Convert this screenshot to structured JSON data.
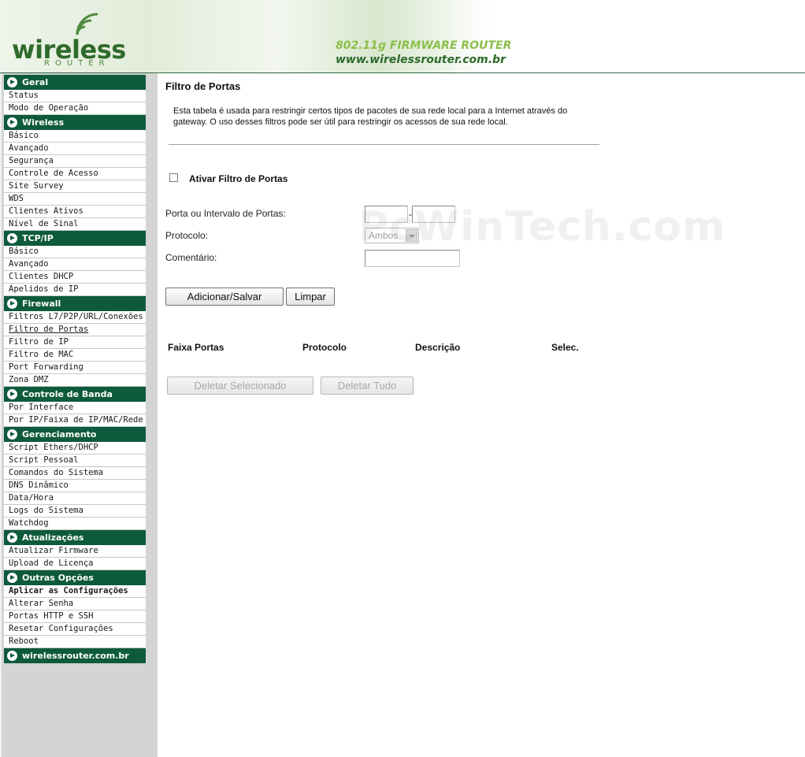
{
  "header": {
    "logo_word": "wireless",
    "logo_sub": "ROUTER",
    "tagline": "802.11g FIRMWARE ROUTER",
    "url": "www.wirelessrouter.com.br"
  },
  "sidebar": {
    "sections": [
      {
        "title": "Geral",
        "items": [
          "Status",
          "Modo de Operação"
        ]
      },
      {
        "title": "Wireless",
        "items": [
          "Básico",
          "Avançado",
          "Segurança",
          "Controle de Acesso",
          "Site Survey",
          "WDS",
          "Clientes Ativos",
          "Nível de Sinal"
        ]
      },
      {
        "title": "TCP/IP",
        "items": [
          "Básico",
          "Avançado",
          "Clientes DHCP",
          "Apelidos de IP"
        ]
      },
      {
        "title": "Firewall",
        "items": [
          "Filtros L7/P2P/URL/Conexões",
          "Filtro de Portas",
          "Filtro de IP",
          "Filtro de MAC",
          "Port Forwarding",
          "Zona DMZ"
        ]
      },
      {
        "title": "Controle de Banda",
        "items": [
          "Por Interface",
          "Por IP/Faixa de IP/MAC/Rede"
        ]
      },
      {
        "title": "Gerenciamento",
        "items": [
          "Script Ethers/DHCP",
          "Script Pessoal",
          "Comandos do Sistema",
          "DNS Dinâmico",
          "Data/Hora",
          "Logs do Sistema",
          "Watchdog"
        ]
      },
      {
        "title": "Atualizações",
        "items": [
          "Atualizar Firmware",
          "Upload de Licença"
        ]
      },
      {
        "title": "Outras Opções",
        "items": [
          "Aplicar as Configurações",
          "Alterar Senha",
          "Portas HTTP e SSH",
          "Resetar Configurações",
          "Reboot"
        ]
      },
      {
        "title": "wirelessrouter.com.br",
        "items": []
      }
    ],
    "active_item": "Filtro de Portas",
    "bold_item": "Aplicar as Configurações"
  },
  "main": {
    "title": "Filtro de Portas",
    "description": "Esta tabela é usada para restringir certos tipos de pacotes de sua rede local para a Internet através do gateway. O uso desses filtros pode ser útil para restringir os acessos de sua rede local.",
    "enable_label": "Ativar Filtro de Portas",
    "enable_checked": false,
    "port_label": "Porta ou Intervalo de Portas:",
    "port_from": "",
    "port_separator": "-",
    "port_to": "",
    "protocol_label": "Protocolo:",
    "protocol_value": "Ambos",
    "comment_label": "Comentário:",
    "comment_value": "",
    "save_button": "Adicionar/Salvar",
    "clear_button": "Limpar",
    "table_headers": [
      "Faixa Portas",
      "Protocolo",
      "Descrição",
      "Selec."
    ],
    "delete_selected_button": "Deletar Selecionado",
    "delete_all_button": "Deletar Tudo"
  },
  "watermark": "PcWinTech.com",
  "colors": {
    "nav_section": "#0e5a3c",
    "sidebar_bg": "#d4d4d4",
    "logo_green": "#2f6b2b"
  }
}
